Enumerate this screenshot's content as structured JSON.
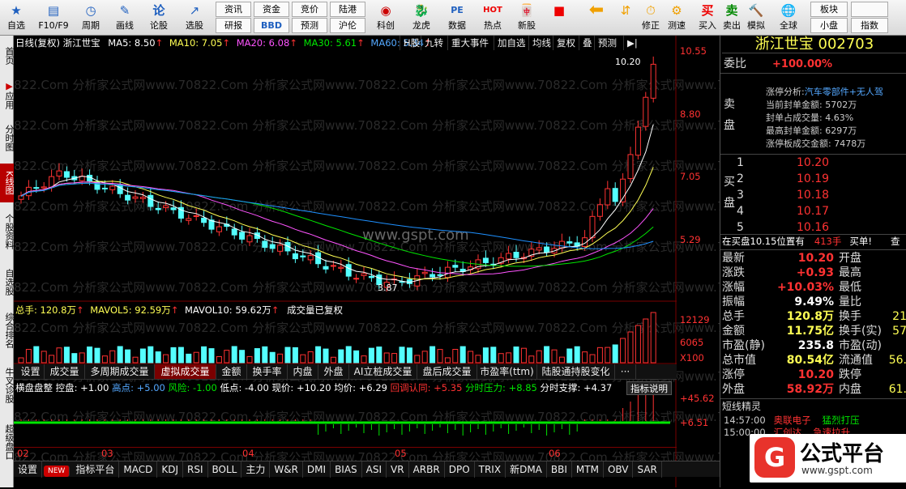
{
  "toolbar": {
    "buttons": [
      {
        "label": "自选",
        "icon": "star-icon"
      },
      {
        "label": "F10/F9",
        "icon": "f10-icon"
      },
      {
        "label": "周期",
        "icon": "clock-icon"
      },
      {
        "label": "画线",
        "icon": "pen-icon"
      },
      {
        "label": "论股",
        "icon": "comment-icon"
      },
      {
        "label": "选股",
        "icon": "stock-select-icon"
      }
    ],
    "small": [
      [
        "资讯",
        "研报"
      ],
      [
        "资金",
        "BBD"
      ],
      [
        "竞价",
        "预测"
      ],
      [
        "陆港",
        "沪伦"
      ]
    ],
    "buttons2": [
      {
        "label": "科创",
        "icon": "science-icon"
      },
      {
        "label": "龙虎",
        "icon": "dragon-icon"
      },
      {
        "label": "数据",
        "icon": "data-icon"
      },
      {
        "label": "热点",
        "icon": "hot-icon"
      },
      {
        "label": "新股",
        "icon": "new-stock-icon"
      }
    ],
    "buttons3": [
      {
        "label": "",
        "icon": "red-square-icon"
      },
      {
        "label": "",
        "icon": "arrow-left-icon"
      },
      {
        "label": "",
        "icon": "up-down-icon"
      },
      {
        "label": "修正",
        "icon": "fix-icon"
      },
      {
        "label": "测速",
        "icon": "speed-icon"
      },
      {
        "label": "买入",
        "icon": "buy-icon"
      },
      {
        "label": "卖出",
        "icon": "sell-icon"
      },
      {
        "label": "模拟",
        "icon": "simulate-icon"
      },
      {
        "label": "全球",
        "icon": "globe-icon"
      }
    ],
    "small2": [
      [
        "板块",
        "小盘"
      ],
      [
        "",
        "指数"
      ]
    ],
    "buy_glyph": "买",
    "sell_glyph": "卖",
    "mo_glyph": "模"
  },
  "sidebar": [
    "首页",
    "应用",
    "分时图",
    "K线图",
    "个股资料",
    "自选股",
    "综合排名",
    "牛叉诊股",
    "超级盘口"
  ],
  "header": {
    "title": "日线(复权) 浙江世宝",
    "ma5": "MA5: 8.50",
    "ma10": "MA10: 7.05",
    "ma20": "MA20: 6.08",
    "ma30": "MA30: 5.61",
    "ma60": "MA60: 5.34",
    "buttons": [
      "H股",
      "九转",
      "重大事件",
      "加自选",
      "均线",
      "复权",
      "叠",
      "预测",
      "▶|"
    ]
  },
  "price_axis": [
    "10.55",
    "8.80",
    "7.05",
    "5.29"
  ],
  "price_labels": {
    "high": "10.20",
    "low": "3.87"
  },
  "watermark": "822.Com 分析家公式网www.70822.Com 分析家公式网www.70822.Com 分析家公式网www.70822.Com 分析家公式网www.70822.Com",
  "gspt": "www.gspt.com",
  "volume": {
    "header": "总手: 120.8万",
    "mavol5": "MAVOL5: 92.59万",
    "mavol10": "MAVOL10: 59.62万",
    "note": "成交量已复权",
    "axis": [
      "12129",
      "6065",
      "X100"
    ]
  },
  "tabs": [
    "设置",
    "成交量",
    "多周期成交量",
    "虚拟成交量",
    "金额",
    "换手率",
    "内盘",
    "外盘",
    "AI立桩成交量",
    "盘后成交量",
    "市盈率(ttm)",
    "陆股通持股变化",
    "···"
  ],
  "indicator": {
    "name": "横盘盘整",
    "items": [
      "控盘: +1.00",
      "高点: +5.00",
      "风险: -1.00",
      "低点: -4.00",
      "现价: +10.20",
      "均价: +6.29",
      "回调认同: +5.35",
      "分时压力: +8.85",
      "分时支撑: +4.37"
    ],
    "button": "指标说明",
    "axis": [
      "+45.62",
      "+6.51"
    ]
  },
  "months": [
    "02",
    "03",
    "04",
    "05",
    "06"
  ],
  "bottom_tabs": [
    "设置",
    "NEW",
    "指标平台",
    "MACD",
    "KDJ",
    "RSI",
    "BOLL",
    "主力",
    "W&R",
    "DMI",
    "BIAS",
    "ASI",
    "VR",
    "ARBR",
    "DPO",
    "TRIX",
    "新DMA",
    "BBI",
    "MTM",
    "OBV",
    "SAR"
  ],
  "right": {
    "name": "浙江世宝",
    "code": "002703",
    "weibi_label": "委比",
    "weibi": "+100.00%",
    "limit": {
      "title": "涨停分析:",
      "concept": "汽车零部件+无人驾",
      "l1": "当前封单金额: 5702万",
      "l2": "封单占成交量: 4.63%",
      "l3": "最高封单金额: 6297万",
      "l4": "涨停板成交金额: 7478万"
    },
    "sell_label": [
      "卖",
      "盘"
    ],
    "buy_label": [
      "买",
      "盘"
    ],
    "buy": [
      [
        "1",
        "10.20"
      ],
      [
        "2",
        "10.19"
      ],
      [
        "3",
        "10.18"
      ],
      [
        "4",
        "10.17"
      ],
      [
        "5",
        "10.16"
      ]
    ],
    "status": "在买盘10.15位置有",
    "status_vol": "413手",
    "status_act": "买单!",
    "status_more": "查",
    "quote": [
      [
        "最新",
        "10.20",
        "开盘",
        ""
      ],
      [
        "涨跌",
        "+0.93",
        "最高",
        ""
      ],
      [
        "涨幅",
        "+10.03%",
        "最低",
        ""
      ],
      [
        "振幅",
        "9.49%",
        "量比",
        ""
      ],
      [
        "总手",
        "120.8万",
        "换手",
        "21"
      ],
      [
        "金额",
        "11.75亿",
        "换手(实)",
        "57"
      ],
      [
        "市盈(静)",
        "235.8",
        "市盈(动)",
        ""
      ],
      [
        "总市值",
        "80.54亿",
        "流通值",
        "56."
      ],
      [
        "涨停",
        "10.20",
        "跌停",
        ""
      ],
      [
        "外盘",
        "58.92万",
        "内盘",
        "61."
      ]
    ],
    "short_title": "短线精灵",
    "short": [
      [
        "14:57:00",
        "奥联电子",
        "猛烈打压"
      ],
      [
        "15:00:00",
        "汇创达",
        "急速拉升"
      ]
    ],
    "logo": "公式平台",
    "logo_url": "www.gspt.com"
  },
  "colors": {
    "up": "#ff3232",
    "down": "#54ffff",
    "ma5": "#ffffff",
    "ma10": "#ffff54",
    "ma20": "#ff54ff",
    "ma30": "#00e600",
    "ma60": "#1e90ff"
  }
}
